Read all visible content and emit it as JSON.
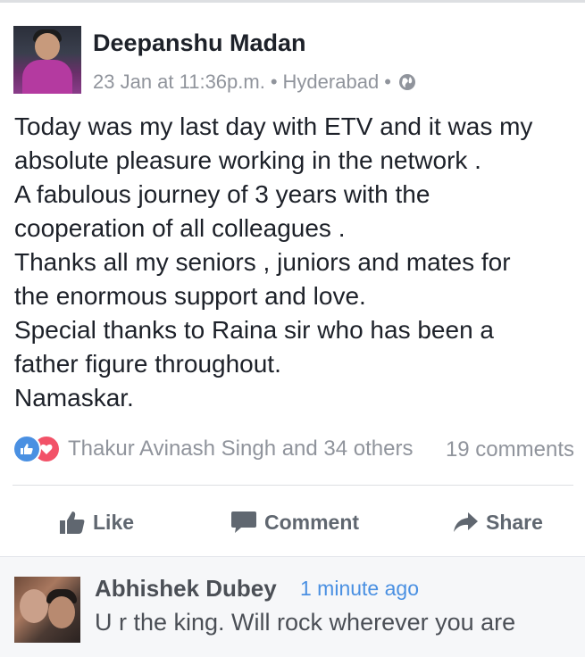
{
  "post": {
    "author": "Deepanshu Madan",
    "date": "23 Jan at 11:36p.m.",
    "separator": "•",
    "location": "Hyderabad",
    "privacy_icon": "globe-icon",
    "lines": [
      "Today was my last day with ETV and it was my",
      "absolute pleasure working in the network .",
      "A fabulous journey of 3 years with the",
      "cooperation of all colleagues .",
      "Thanks all my seniors , juniors and mates for",
      "the enormous support and love.",
      "Special thanks to Raina sir who has been a",
      "father figure throughout.",
      "Namaskar."
    ],
    "reactions_text": "Thakur Avinash Singh and 34 others",
    "comments_count": "19 comments"
  },
  "actions": {
    "like": "Like",
    "comment": "Comment",
    "share": "Share"
  },
  "comment": {
    "author": "Abhishek Dubey",
    "time": "1 minute ago",
    "text": "U r the king. Will rock wherever you are"
  },
  "colors": {
    "link_blue": "#4a90e2",
    "like_blue": "#4a90e2",
    "love_red": "#f25268",
    "muted_gray": "#90949c"
  }
}
